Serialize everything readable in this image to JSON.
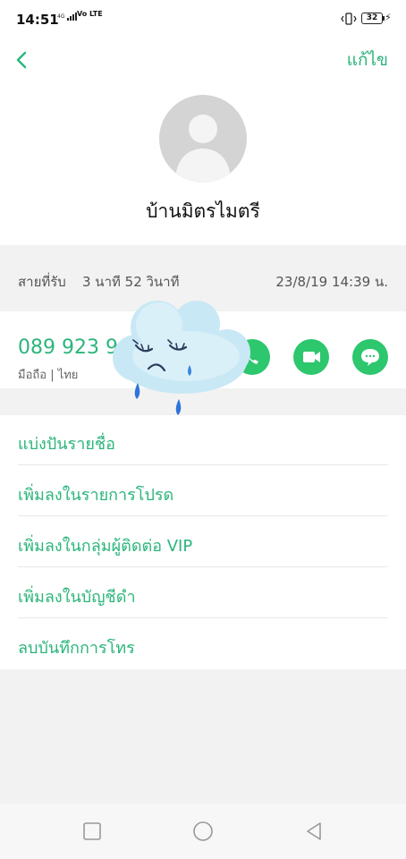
{
  "status_bar": {
    "time": "14:51",
    "network_small": "4G",
    "network_lte": "Vo LTE",
    "battery": "32"
  },
  "header": {
    "edit_label": "แก้ไข",
    "contact_name": "บ้านมิตรไมตรี"
  },
  "call_log": {
    "type": "สายที่รับ",
    "duration": "3 นาที 52 วินาที",
    "datetime": "23/8/19 14:39 น."
  },
  "phone": {
    "number": "089 923 9",
    "meta": "มือถือ | ไทย"
  },
  "menu": {
    "items": [
      {
        "label": "แบ่งปันรายชื่อ"
      },
      {
        "label": "เพิ่มลงในรายการโปรด"
      },
      {
        "label": "เพิ่มลงในกลุ่มผู้ติดต่อ VIP"
      },
      {
        "label": "เพิ่มลงในบัญชีดำ"
      },
      {
        "label": "ลบบันทึกการโทร"
      }
    ]
  },
  "colors": {
    "accent": "#2bb57b",
    "action_green": "#2dc76d"
  }
}
